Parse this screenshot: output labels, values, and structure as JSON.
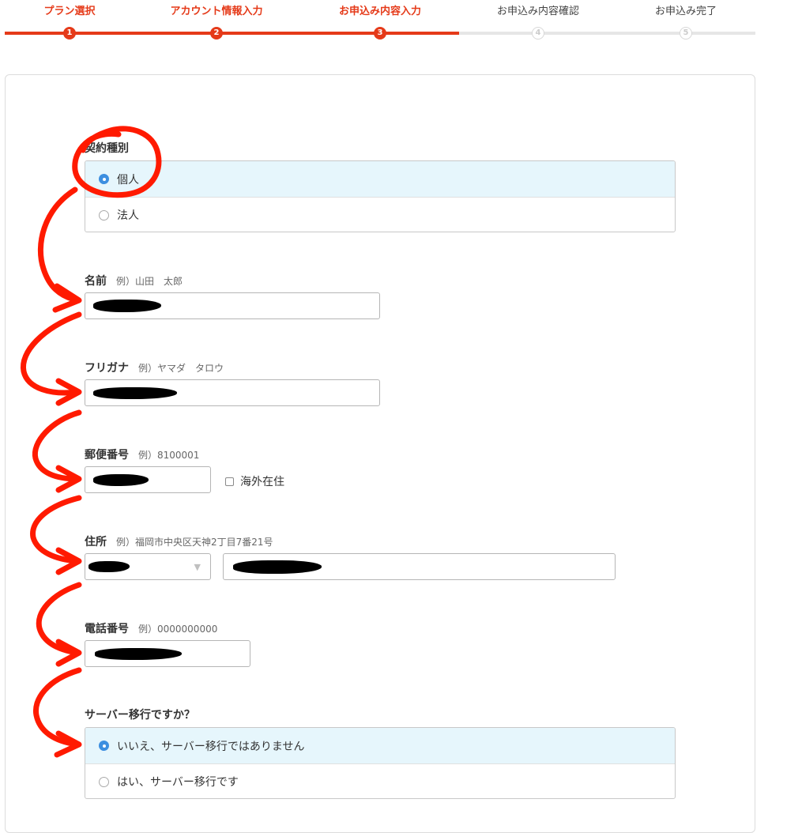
{
  "steps": [
    {
      "label": "プラン選択",
      "num": "1"
    },
    {
      "label": "アカウント情報入力",
      "num": "2"
    },
    {
      "label": "お申込み内容入力",
      "num": "3"
    },
    {
      "label": "お申込み内容確認",
      "num": "4"
    },
    {
      "label": "お申込み完了",
      "num": "5"
    }
  ],
  "current_step": 3,
  "form": {
    "contract_type": {
      "label": "契約種別",
      "options": [
        "個人",
        "法人"
      ],
      "selected": "個人"
    },
    "name": {
      "label": "名前",
      "example": "例）山田　太郎"
    },
    "furigana": {
      "label": "フリガナ",
      "example": "例）ヤマダ　タロウ"
    },
    "postal_code": {
      "label": "郵便番号",
      "example": "例）8100001",
      "overseas_label": "海外在住",
      "overseas_checked": false
    },
    "address": {
      "label": "住所",
      "example": "例）福岡市中央区天神2丁目7番21号"
    },
    "phone": {
      "label": "電話番号",
      "example": "例）0000000000"
    },
    "server_migration": {
      "label": "サーバー移行ですか？",
      "options": [
        "いいえ、サーバー移行ではありません",
        "はい、サーバー移行です"
      ],
      "selected": "いいえ、サーバー移行ではありません"
    }
  },
  "colors": {
    "accent": "#e53a19",
    "selected_bg": "#e6f6fc",
    "radio_on": "#3d8fe0",
    "annotation": "#ff1a00"
  }
}
